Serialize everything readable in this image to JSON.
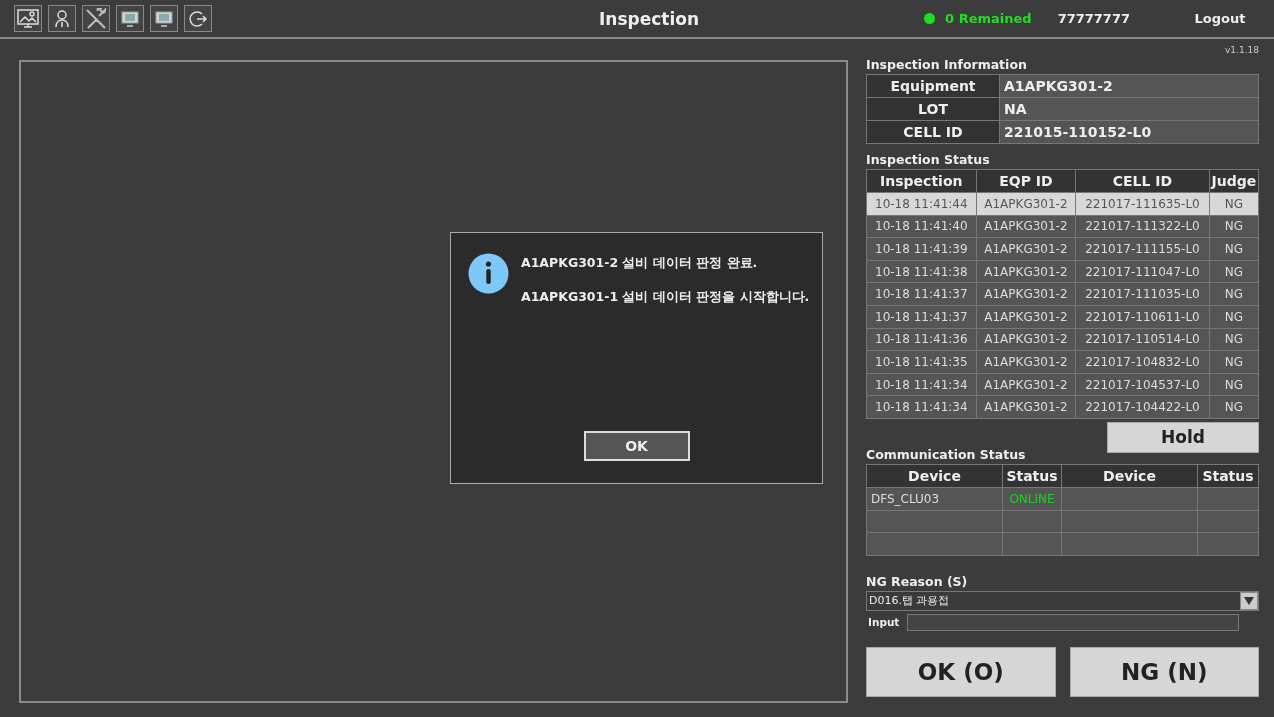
{
  "toolbar": [
    {
      "kind": "picture-monitor"
    },
    {
      "kind": "person"
    },
    {
      "kind": "tools"
    },
    {
      "kind": "monitor"
    },
    {
      "kind": "monitor"
    },
    {
      "kind": "exit"
    }
  ],
  "window": {
    "title": "Inspection"
  },
  "header": {
    "status": {
      "text": "0 Remained",
      "color": "#22dd22"
    },
    "user": "77777777",
    "logout": "Logout"
  },
  "version": "v1.1.18",
  "info": {
    "title": "Inspection Information",
    "rows": [
      {
        "label": "Equipment",
        "value": "A1APKG301-2"
      },
      {
        "label": "LOT",
        "value": "NA"
      },
      {
        "label": "CELL ID",
        "value": "221015-110152-L0"
      }
    ]
  },
  "status": {
    "title": "Inspection Status",
    "columns": [
      "Inspection",
      "EQP ID",
      "CELL ID",
      "Judge"
    ],
    "rows": [
      {
        "cells": [
          "10-18 11:41:44",
          "A1APKG301-2",
          "221017-111635-L0",
          "NG"
        ],
        "selected": true
      },
      {
        "cells": [
          "10-18 11:41:40",
          "A1APKG301-2",
          "221017-111322-L0",
          "NG"
        ],
        "selected": false
      },
      {
        "cells": [
          "10-18 11:41:39",
          "A1APKG301-2",
          "221017-111155-L0",
          "NG"
        ],
        "selected": false
      },
      {
        "cells": [
          "10-18 11:41:38",
          "A1APKG301-2",
          "221017-111047-L0",
          "NG"
        ],
        "selected": false
      },
      {
        "cells": [
          "10-18 11:41:37",
          "A1APKG301-2",
          "221017-111035-L0",
          "NG"
        ],
        "selected": false
      },
      {
        "cells": [
          "10-18 11:41:37",
          "A1APKG301-2",
          "221017-110611-L0",
          "NG"
        ],
        "selected": false
      },
      {
        "cells": [
          "10-18 11:41:36",
          "A1APKG301-2",
          "221017-110514-L0",
          "NG"
        ],
        "selected": false
      },
      {
        "cells": [
          "10-18 11:41:35",
          "A1APKG301-2",
          "221017-104832-L0",
          "NG"
        ],
        "selected": false
      },
      {
        "cells": [
          "10-18 11:41:34",
          "A1APKG301-2",
          "221017-104537-L0",
          "NG"
        ],
        "selected": false
      },
      {
        "cells": [
          "10-18 11:41:34",
          "A1APKG301-2",
          "221017-104422-L0",
          "NG"
        ],
        "selected": false
      }
    ]
  },
  "hold_button": "Hold",
  "communication": {
    "title": "Communication Status",
    "columns": [
      "Device",
      "Status",
      "Device",
      "Status"
    ],
    "rows": [
      {
        "kind": "filled",
        "device": "DFS_CLU03",
        "status": "ONLINE",
        "color": "#22cc22"
      },
      {
        "kind": "empty"
      },
      {
        "kind": "empty"
      }
    ]
  },
  "ng_reason": {
    "title": "NG Reason (S)",
    "value": "D016.탭 과용접",
    "input_label": "Input"
  },
  "buttons": [
    "OK (O)",
    "NG (N)"
  ],
  "dialog": {
    "lines": [
      "A1APKG301-2 설비 데이터 판정 완료.",
      "A1APKG301-1 설비 데이터 판정을 시작합니다."
    ],
    "button": "OK"
  }
}
